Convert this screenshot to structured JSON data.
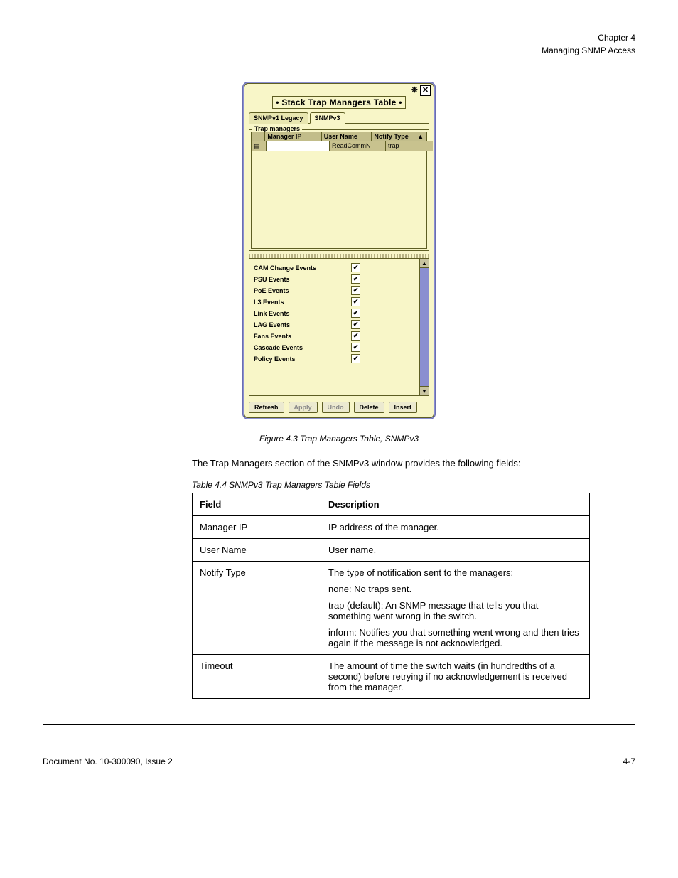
{
  "header": {
    "chapter": "Chapter 4",
    "title": "Managing SNMP Access"
  },
  "dialog": {
    "title": "• Stack Trap Managers Table •",
    "tabs": [
      {
        "label": "SNMPv1 Legacy",
        "active": false
      },
      {
        "label": "SNMPv3",
        "active": true
      }
    ],
    "fieldset_legend": "Trap managers",
    "columns": {
      "manager_ip": "Manager IP",
      "user_name": "User Name",
      "notify_type": "Notify Type"
    },
    "rowicon_glyph": "▤",
    "row1": {
      "manager_ip": "",
      "user_name": "ReadCommN",
      "notify_type": "trap"
    },
    "events": [
      {
        "label": "CAM Change Events",
        "checked": true
      },
      {
        "label": "PSU Events",
        "checked": true
      },
      {
        "label": "PoE Events",
        "checked": true
      },
      {
        "label": "L3 Events",
        "checked": true
      },
      {
        "label": "Link Events",
        "checked": true
      },
      {
        "label": "LAG Events",
        "checked": true
      },
      {
        "label": "Fans Events",
        "checked": true
      },
      {
        "label": "Cascade Events",
        "checked": true
      },
      {
        "label": "Policy Events",
        "checked": true
      }
    ],
    "buttons": {
      "refresh": "Refresh",
      "apply": "Apply",
      "undo": "Undo",
      "delete": "Delete",
      "insert": "Insert"
    },
    "scroll_up": "▲",
    "scroll_down": "▼",
    "check_glyph": "✔"
  },
  "figure_caption": "Figure 4.3    Trap Managers Table, SNMPv3",
  "intro_text": "The Trap Managers section of the SNMPv3 window provides the following fields:",
  "table_caption": "Table 4.4   SNMPv3 Trap Managers Table Fields",
  "field_table": {
    "headers": {
      "field": "Field",
      "description": "Description"
    },
    "rows": [
      {
        "field": "Manager IP",
        "description": "IP address of the manager."
      },
      {
        "field": "User Name",
        "description": "User name."
      },
      {
        "field": "Notify Type",
        "description_lines": [
          "The type of notification sent to the managers:",
          "none: No traps sent.",
          "trap (default): An SNMP message that tells you that something went wrong in the switch.",
          "inform: Notifies you that something went wrong and then tries again if the message is not acknowledged."
        ]
      },
      {
        "field": "Timeout",
        "description": "The amount of time the switch waits (in hundredths of a second) before retrying if no acknowledgement is received from the manager."
      }
    ]
  },
  "footer": {
    "doc_id": "Document No. 10-300090, Issue 2",
    "page": "4-7"
  }
}
